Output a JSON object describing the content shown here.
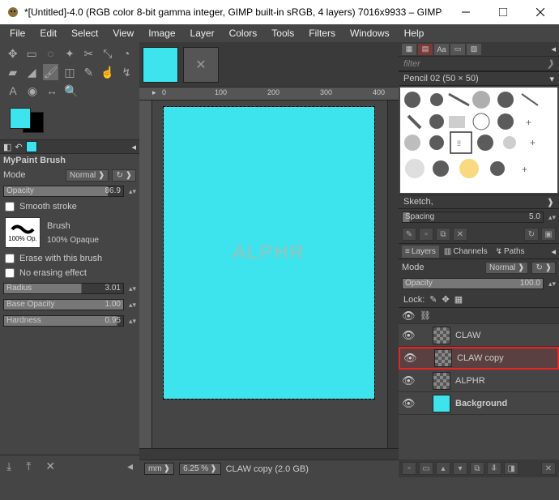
{
  "window": {
    "title": "*[Untitled]-4.0 (RGB color 8-bit gamma integer, GIMP built-in sRGB, 4 layers) 7016x9933 – GIMP"
  },
  "menu": {
    "items": [
      "File",
      "Edit",
      "Select",
      "View",
      "Image",
      "Layer",
      "Colors",
      "Tools",
      "Filters",
      "Windows",
      "Help"
    ]
  },
  "toolOptions": {
    "title": "MyPaint Brush",
    "modeLabel": "Mode",
    "modeValue": "Normal",
    "opacityLabel": "Opacity",
    "opacityValue": "86.9",
    "smoothStroke": "Smooth stroke",
    "brushLabel": "Brush",
    "brushOpacity": "100% Op.",
    "brushOpaque": "100% Opaque",
    "eraseWith": "Erase with this brush",
    "noErasing": "No erasing effect",
    "radiusLabel": "Radius",
    "radiusValue": "3.01",
    "baseOpLabel": "Base Opacity",
    "baseOpValue": "1.00",
    "hardnessLabel": "Hardness",
    "hardnessValue": "0.95"
  },
  "canvas": {
    "watermark": "ALPHR"
  },
  "rulerMarks": {
    "m0": "0",
    "m100": "100",
    "m200": "200",
    "m300": "300",
    "m400": "400"
  },
  "status": {
    "unit": "mm",
    "zoom": "6.25 %",
    "layerInfo": "CLAW copy (2.0 GB)"
  },
  "brushes": {
    "filter": "filter",
    "current": "Pencil 02 (50 × 50)",
    "category": "Sketch,",
    "spacingLabel": "Spacing",
    "spacingValue": "5.0"
  },
  "layersPanel": {
    "tabLayers": "Layers",
    "tabChannels": "Channels",
    "tabPaths": "Paths",
    "modeLabel": "Mode",
    "modeValue": "Normal",
    "opacityLabel": "Opacity",
    "opacityValue": "100.0",
    "lockLabel": "Lock:",
    "layers": [
      {
        "name": "CLAW"
      },
      {
        "name": "CLAW copy"
      },
      {
        "name": "ALPHR"
      },
      {
        "name": "Background"
      }
    ]
  }
}
